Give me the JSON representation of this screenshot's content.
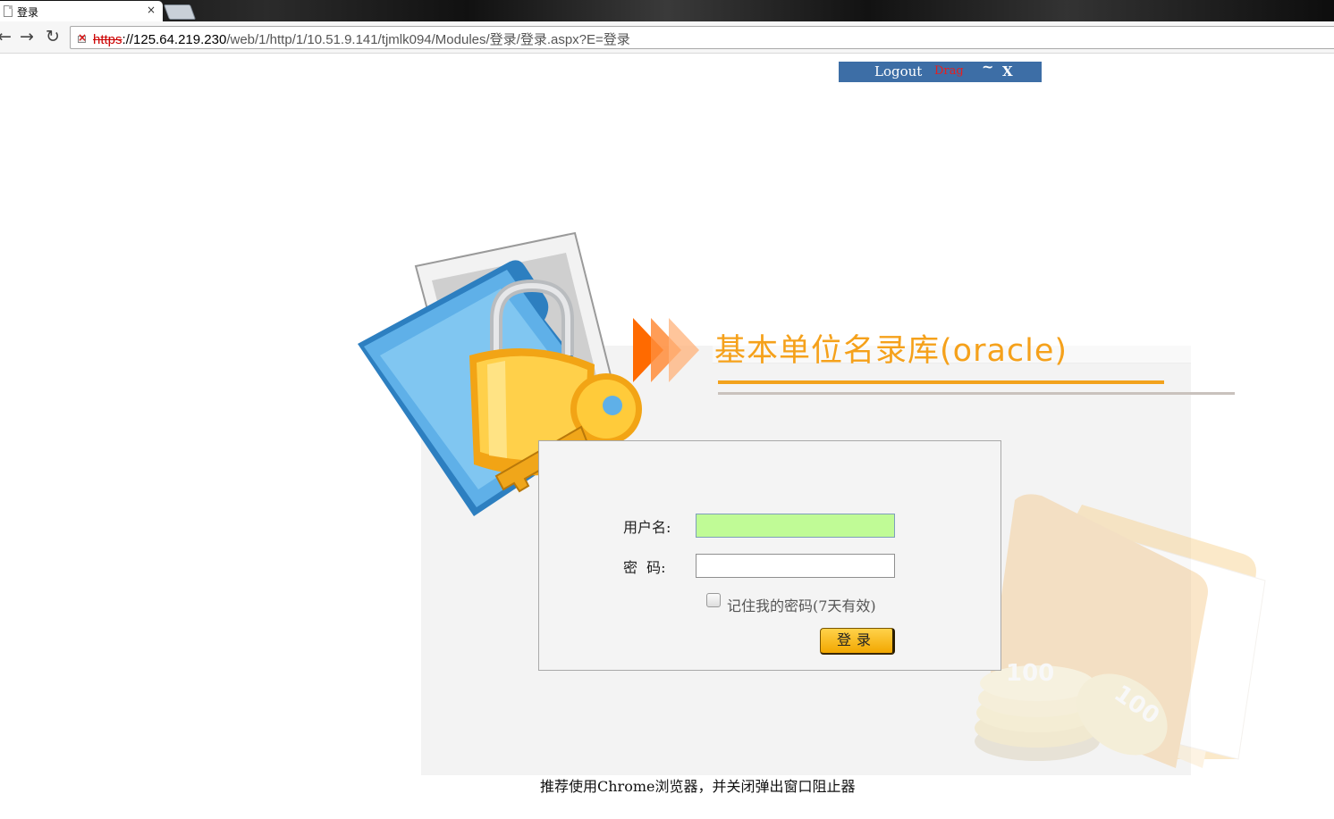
{
  "browser": {
    "tab_title": "登录",
    "tab_close": "×",
    "url_scheme": "https",
    "url_host": "://125.64.219.230",
    "url_path": "/web/1/http/1/10.51.9.141/tjmlk094/Modules/登录/登录.aspx?E=登录"
  },
  "floating_bar": {
    "logout": "Logout",
    "drag": "Drag",
    "minimize": "~",
    "close": "X"
  },
  "login": {
    "system_title": "基本单位名录库(oracle)",
    "username_label": "用户名:",
    "username_value": "",
    "password_label": "密  码:",
    "password_value": "",
    "remember_label": "记住我的密码(7天有效)",
    "remember_checked": false,
    "submit_label": "登录"
  },
  "footer": {
    "tip": "推荐使用Chrome浏览器，并关闭弹出窗口阻止器"
  },
  "colors": {
    "accent_orange": "#f5a11b",
    "username_bg": "#c0fb96",
    "bar_blue": "#3d6ea6",
    "drag_red": "#e81e1e"
  }
}
